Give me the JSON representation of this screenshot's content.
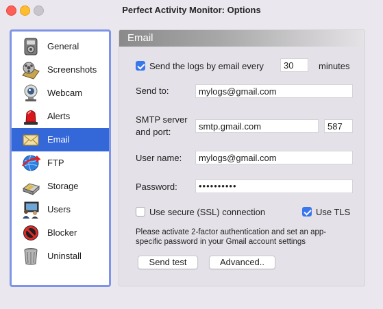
{
  "window": {
    "title": "Perfect Activity Monitor: Options",
    "buttons": [
      "close",
      "minimize",
      "zoom"
    ]
  },
  "sidebar": {
    "selected": "Email",
    "items": [
      {
        "label": "General",
        "icon": "settings-box-icon"
      },
      {
        "label": "Screenshots",
        "icon": "film-reel-icon"
      },
      {
        "label": "Webcam",
        "icon": "webcam-icon"
      },
      {
        "label": "Alerts",
        "icon": "siren-icon"
      },
      {
        "label": "Email",
        "icon": "envelope-icon"
      },
      {
        "label": "FTP",
        "icon": "globe-arrow-icon"
      },
      {
        "label": "Storage",
        "icon": "storage-drive-icon"
      },
      {
        "label": "Users",
        "icon": "users-computer-icon"
      },
      {
        "label": "Blocker",
        "icon": "blocked-icon"
      },
      {
        "label": "Uninstall",
        "icon": "trash-can-icon"
      }
    ]
  },
  "panel": {
    "title": "Email",
    "send_logs": {
      "checked": true,
      "label": "Send the logs by email every",
      "interval": "30",
      "unit": "minutes"
    },
    "send_to": {
      "label": "Send to:",
      "value": "mylogs@gmail.com"
    },
    "smtp": {
      "label_line1": "SMTP server",
      "label_line2": "and port:",
      "server": "smtp.gmail.com",
      "port": "587"
    },
    "username": {
      "label": "User name:",
      "value": "mylogs@gmail.com"
    },
    "password": {
      "label": "Password:",
      "value": "••••••••••"
    },
    "ssl": {
      "checked": false,
      "label": "Use secure (SSL) connection"
    },
    "tls": {
      "checked": true,
      "label": "Use TLS"
    },
    "note_line1": "Please activate 2-factor authentication and set an app-",
    "note_line2": "specific password in your Gmail account settings",
    "send_test_button": "Send test",
    "advanced_button": "Advanced.."
  },
  "colors": {
    "selection": "#3467d7",
    "sidebar_border": "#7e95e6",
    "checkbox_accent": "#3a77ed",
    "window_background": "#ebe7ee"
  }
}
